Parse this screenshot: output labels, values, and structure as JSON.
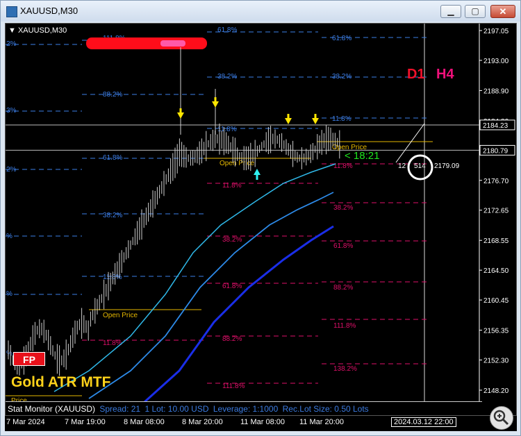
{
  "window": {
    "title": "XAUUSD,M30"
  },
  "chart": {
    "symbol_label": "XAUUSD,M30",
    "badge": "FP",
    "indicator_name": "Gold ATR MTF",
    "tf_d1": "D1",
    "tf_h4": "H4",
    "timer": "< 18:21",
    "tick_count": "12",
    "circle_value": "514",
    "price_readout": "2179.09",
    "current_prices": [
      "2184.23",
      "2180.79"
    ],
    "price_axis": [
      "2197.05",
      "2193.00",
      "2188.90",
      "2184.80",
      "2180.75",
      "2176.70",
      "2172.65",
      "2168.55",
      "2164.50",
      "2160.45",
      "2156.35",
      "2152.30",
      "2148.20"
    ],
    "time_axis": [
      "7 Mar 2024",
      "7 Mar 19:00",
      "8 Mar 08:00",
      "8 Mar 20:00",
      "11 Mar 08:00",
      "11 Mar 20:00"
    ],
    "cursor_time": "2024.03.12 22:00",
    "blue_levels": [
      "61.8%",
      "38.2%",
      "11.8%",
      "88.2%",
      "61.8%",
      "38.2%",
      "11.8%",
      "111.8%",
      "88.2%",
      "61.8%",
      "38.2%",
      "11.8%",
      "61.8%",
      "38.2%",
      "11.8%"
    ],
    "pink_levels": [
      "11.8%",
      "11.8%",
      "38.2%",
      "61.8%",
      "88.2%",
      "111.8%",
      "138.2%",
      "38.2%",
      "61.8%",
      "88.2%",
      "111.8%",
      "11.8%"
    ],
    "open_price_labels": [
      "Open Price",
      "Open Price",
      "Open Price",
      "Price"
    ],
    "edge_labels": [
      "2%",
      "3%",
      "2%",
      "%",
      "%",
      "%"
    ]
  },
  "stat_monitor": {
    "label": "Stat Monitor (XAUUSD)",
    "spread": "Spread: 21",
    "lot": "1 Lot: 10.00 USD",
    "leverage": "Leverage: 1:1000",
    "rec_lot": "Rec.Lot Size: 0.50 Lots"
  },
  "colors": {
    "background": "#000000",
    "blue_fib": "#3d7fe8",
    "pink_fib": "#e0106a",
    "open_price": "#e6b800",
    "ma_light": "#2fb8e8",
    "ma_mid": "#2d8ae8",
    "ma_dark": "#1a2ee8"
  },
  "icons": {
    "zoom": "zoom-in-icon"
  }
}
